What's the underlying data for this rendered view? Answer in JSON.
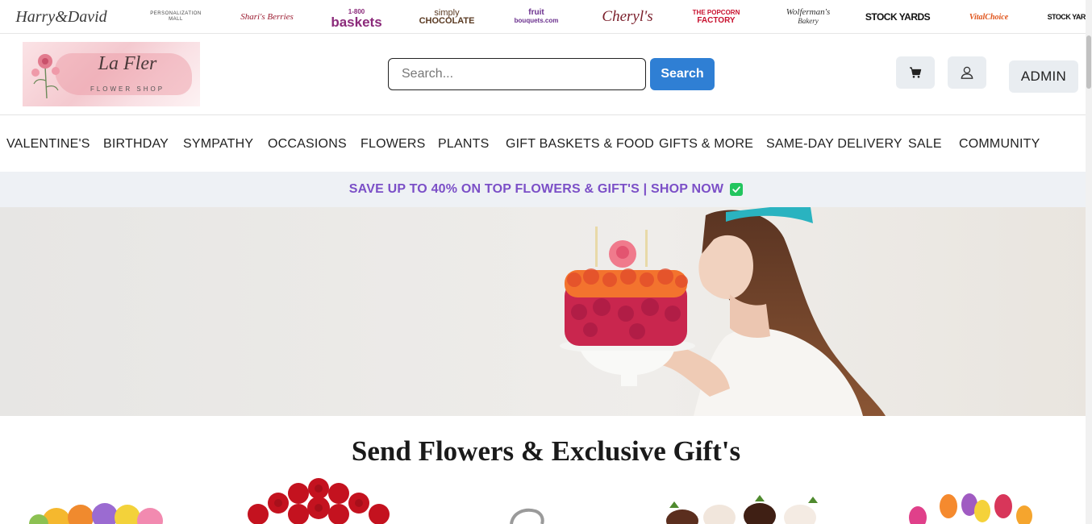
{
  "brands": {
    "harry_david": "Harry&David",
    "personalization_mall_top": "PERSONALIZATION",
    "personalization_mall_bottom": "MALL",
    "sharis": "Shari's Berries",
    "baskets_top": "1-800",
    "baskets": "baskets",
    "simply_top": "simply",
    "simply_bottom": "CHOCOLATE",
    "fruit_top": "fruit",
    "fruit_bottom": "bouquets.com",
    "cheryls": "Cheryl's",
    "popcorn_top": "THE POPCORN",
    "popcorn_bottom": "FACTORY",
    "wolfermans_top": "Wolferman's",
    "wolfermans_bottom": "Bakery",
    "stockyards": "STOCK YARDS",
    "vitalchoice": "VitalChoice",
    "stockyards2": "STOCK YARDS"
  },
  "logo": {
    "script": "La Fler",
    "subtitle": "FLOWER SHOP"
  },
  "search": {
    "placeholder": "Search...",
    "button_label": "Search"
  },
  "header": {
    "cart_icon": "cart-icon",
    "user_icon": "user-icon",
    "admin_label": "ADMIN"
  },
  "nav": [
    {
      "label": "VALENTINE'S"
    },
    {
      "label": "BIRTHDAY"
    },
    {
      "label": "SYMPATHY"
    },
    {
      "label": "OCCASIONS"
    },
    {
      "label": "FLOWERS"
    },
    {
      "label": "PLANTS"
    },
    {
      "label": "GIFT BASKETS & FOOD"
    },
    {
      "label": "GIFTS & MORE"
    },
    {
      "label": "SAME-DAY DELIVERY"
    },
    {
      "label": "SALE"
    },
    {
      "label": "COMMUNITY"
    }
  ],
  "promo": {
    "text": "SAVE UP TO 40% ON TOP FLOWERS & GIFT'S | SHOP NOW",
    "icon": "check-icon"
  },
  "section": {
    "title": "Send Flowers & Exclusive Gift's"
  },
  "colors": {
    "accent": "#2f7fd4",
    "promo_text": "#7b4fc7",
    "promo_bg": "#eef1f5",
    "check": "#22c55e"
  }
}
